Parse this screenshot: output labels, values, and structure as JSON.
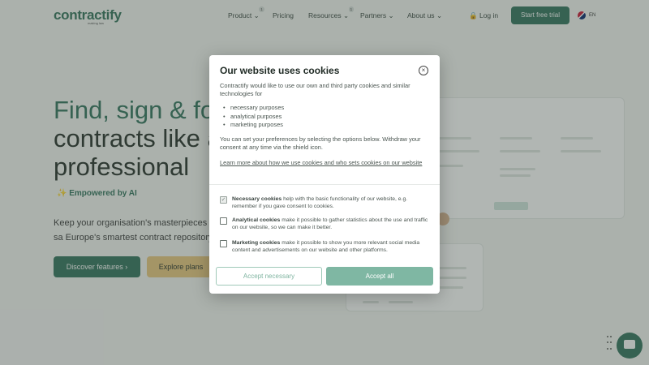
{
  "nav": {
    "logo": "contractify",
    "logo_sub": "making law",
    "links": [
      {
        "label": "Product",
        "chev": "⌄",
        "badge": "1"
      },
      {
        "label": "Pricing",
        "chev": "",
        "badge": ""
      },
      {
        "label": "Resources",
        "chev": "⌄",
        "badge": "1"
      },
      {
        "label": "Partners",
        "chev": "⌄",
        "badge": ""
      },
      {
        "label": "About us",
        "chev": "⌄",
        "badge": ""
      }
    ],
    "login": "Log in",
    "cta": "Start free trial",
    "lang": "EN"
  },
  "hero": {
    "title_accent": "Find, sign & fol",
    "title_line2": "contracts like a",
    "title_line3": "professional",
    "ai_badge": "Empowered by AI",
    "text": "Keep your organisation's masterpieces sa Europe's smartest contract repository.",
    "btn_discover": "Discover features ›",
    "btn_explore": "Explore plans"
  },
  "cookie": {
    "title": "Our website uses cookies",
    "close": "×",
    "intro": "Contractify would like to use our own and third party cookies and similar technologies for",
    "purposes": [
      "necessary purposes",
      "analytical purposes",
      "marketing purposes"
    ],
    "prefs": "You can set your preferences by selecting the options below. Withdraw your consent at any time via the shield icon.",
    "learn_more": "Learn more about how we use cookies and who sets cookies on our website",
    "options": [
      {
        "name": "Necessary cookies",
        "desc": " help with the basic functionality of our website, e.g. remember if you gave consent to cookies.",
        "checked": true
      },
      {
        "name": "Analytical cookies",
        "desc": " make it possible to gather statistics about the use and traffic on our website, so we can make it better.",
        "checked": false
      },
      {
        "name": "Marketing cookies",
        "desc": " make it possible to show you more relevant social media content and advertisements on our website and other platforms.",
        "checked": false
      }
    ],
    "accept_necessary": "Accept necessary",
    "accept_all": "Accept all",
    "check_mark": "✓"
  },
  "colors": {
    "brand": "#2c6f58",
    "accent_btn": "#7fb7a3",
    "explore": "#e8c67a"
  }
}
